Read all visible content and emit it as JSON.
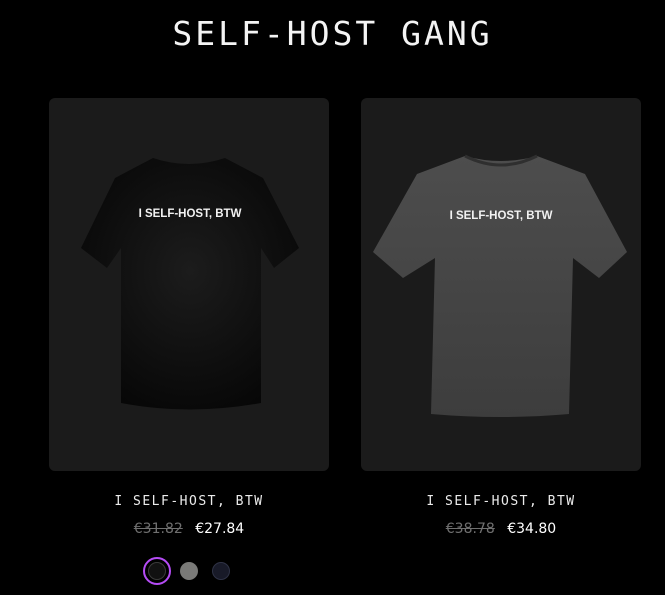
{
  "section": {
    "title": "SELF-HOST GANG"
  },
  "products": [
    {
      "name": "I SELF-HOST, BTW",
      "print_text": "I SELF-HOST, BTW",
      "old_price": "€31.82",
      "new_price": "€27.84",
      "shirt_color": "#0c0c0c",
      "swatches": [
        {
          "color": "#111111",
          "selected": true
        },
        {
          "color": "#7a7a78",
          "selected": false
        },
        {
          "color": "#181a28",
          "selected": false
        }
      ]
    },
    {
      "name": "I SELF-HOST, BTW",
      "print_text": "I SELF-HOST, BTW",
      "old_price": "€38.78",
      "new_price": "€34.80",
      "shirt_color": "#454545"
    }
  ],
  "colors": {
    "background": "#000000",
    "card_background": "#1b1b1b",
    "selected_swatch_ring": "#b54cf5"
  }
}
